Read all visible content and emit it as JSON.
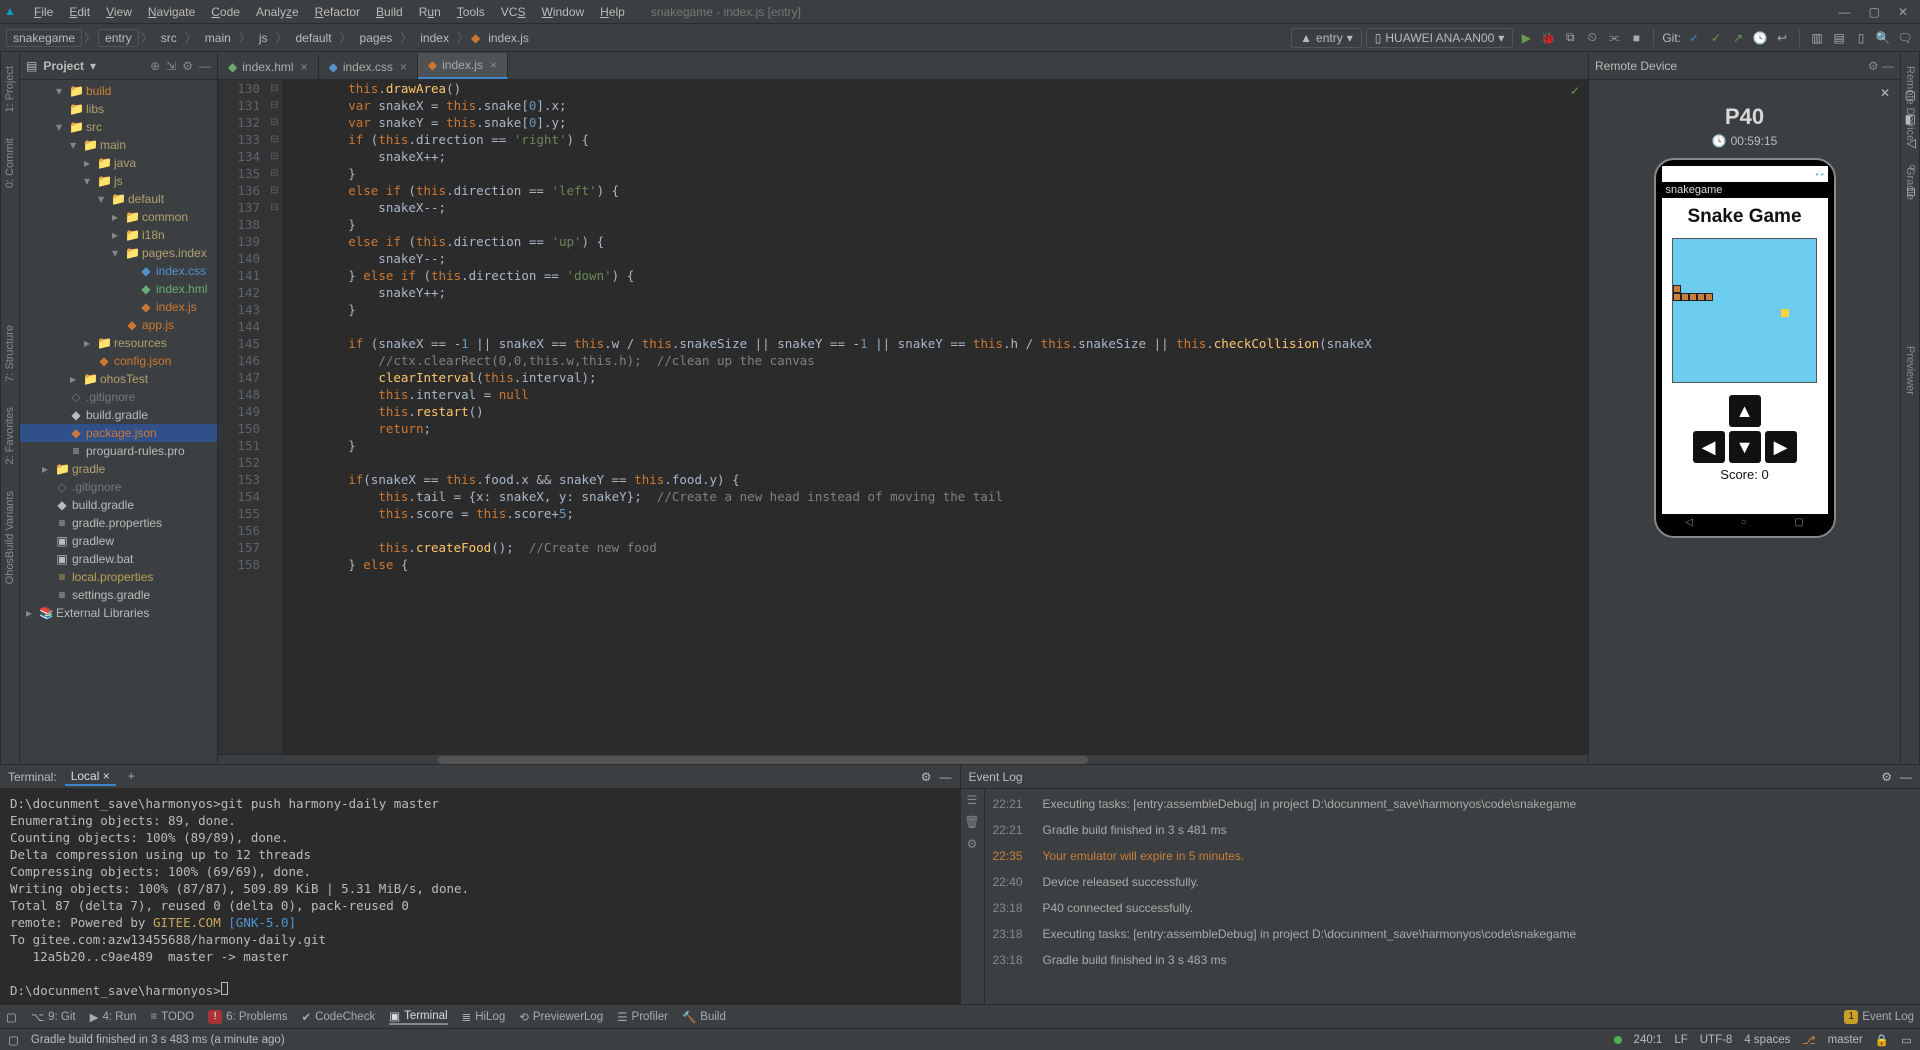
{
  "window": {
    "title": "snakegame - index.js [entry]"
  },
  "menu": [
    "File",
    "Edit",
    "View",
    "Navigate",
    "Code",
    "Analyze",
    "Refactor",
    "Build",
    "Run",
    "Tools",
    "VCS",
    "Window",
    "Help"
  ],
  "breadcrumbs": [
    "snakegame",
    "entry",
    "src",
    "main",
    "js",
    "default",
    "pages",
    "index",
    "index.js"
  ],
  "runConfig": "entry",
  "device": "HUAWEI ANA-AN00",
  "gitLabel": "Git:",
  "leftTabs": [
    "1: Project",
    "0: Commit",
    "7: Structure",
    "2: Favorites",
    "OhosBuild Variants"
  ],
  "rightTabs": [
    "Remote Device",
    "Gradle",
    "Previewer"
  ],
  "projectPanel": {
    "title": "Project"
  },
  "tree": [
    {
      "d": 1,
      "a": "▾",
      "i": "📁",
      "cls": "build-orange",
      "t": "build"
    },
    {
      "d": 1,
      "a": "",
      "i": "📁",
      "cls": "folder",
      "t": "libs"
    },
    {
      "d": 1,
      "a": "▾",
      "i": "📁",
      "cls": "folder",
      "t": "src"
    },
    {
      "d": 2,
      "a": "▾",
      "i": "📁",
      "cls": "folder",
      "t": "main"
    },
    {
      "d": 3,
      "a": "▸",
      "i": "📁",
      "cls": "folder",
      "t": "java"
    },
    {
      "d": 3,
      "a": "▾",
      "i": "📁",
      "cls": "folder",
      "t": "js"
    },
    {
      "d": 4,
      "a": "▾",
      "i": "📁",
      "cls": "folder",
      "t": "default"
    },
    {
      "d": 5,
      "a": "▸",
      "i": "📁",
      "cls": "folder",
      "t": "common"
    },
    {
      "d": 5,
      "a": "▸",
      "i": "📁",
      "cls": "folder",
      "t": "i18n"
    },
    {
      "d": 5,
      "a": "▾",
      "i": "📁",
      "cls": "folder",
      "t": "pages.index"
    },
    {
      "d": 6,
      "a": "",
      "i": "◆",
      "cls": "file-css",
      "t": "index.css"
    },
    {
      "d": 6,
      "a": "",
      "i": "◆",
      "cls": "file-hml",
      "t": "index.hml"
    },
    {
      "d": 6,
      "a": "",
      "i": "◆",
      "cls": "file-js",
      "t": "index.js"
    },
    {
      "d": 5,
      "a": "",
      "i": "◆",
      "cls": "file-js",
      "t": "app.js"
    },
    {
      "d": 3,
      "a": "▸",
      "i": "📁",
      "cls": "folder",
      "t": "resources"
    },
    {
      "d": 3,
      "a": "",
      "i": "◆",
      "cls": "file-json",
      "t": "config.json"
    },
    {
      "d": 2,
      "a": "▸",
      "i": "📁",
      "cls": "folder",
      "t": "ohosTest"
    },
    {
      "d": 1,
      "a": "",
      "i": "◇",
      "cls": "dim",
      "t": ".gitignore"
    },
    {
      "d": 1,
      "a": "",
      "i": "◆",
      "cls": "",
      "t": "build.gradle"
    },
    {
      "d": 1,
      "a": "",
      "i": "◆",
      "cls": "file-json",
      "t": "package.json",
      "sel": true
    },
    {
      "d": 1,
      "a": "",
      "i": "≡",
      "cls": "",
      "t": "proguard-rules.pro"
    },
    {
      "d": 0,
      "a": "▸",
      "i": "📁",
      "cls": "folder",
      "t": "gradle"
    },
    {
      "d": 0,
      "a": "",
      "i": "◇",
      "cls": "dim",
      "t": ".gitignore"
    },
    {
      "d": 0,
      "a": "",
      "i": "◆",
      "cls": "",
      "t": "build.gradle"
    },
    {
      "d": 0,
      "a": "",
      "i": "≡",
      "cls": "",
      "t": "gradle.properties"
    },
    {
      "d": 0,
      "a": "",
      "i": "▣",
      "cls": "",
      "t": "gradlew"
    },
    {
      "d": 0,
      "a": "",
      "i": "▣",
      "cls": "",
      "t": "gradlew.bat"
    },
    {
      "d": 0,
      "a": "",
      "i": "≡",
      "cls": "yellow",
      "t": "local.properties"
    },
    {
      "d": 0,
      "a": "",
      "i": "≡",
      "cls": "",
      "t": "settings.gradle"
    },
    {
      "d": -1,
      "a": "▸",
      "i": "📚",
      "cls": "",
      "t": "External Libraries"
    }
  ],
  "editorTabs": [
    {
      "name": "index.hml",
      "icon": "file-hml"
    },
    {
      "name": "index.css",
      "icon": "file-css"
    },
    {
      "name": "index.js",
      "icon": "file-js",
      "active": true
    }
  ],
  "lineStart": 130,
  "lineEnd": 158,
  "remote": {
    "title": "Remote Device",
    "deviceName": "P40",
    "timer": "00:59:15",
    "appLabel": "snakegame",
    "gameTitle": "Snake Game",
    "score": "Score: 0"
  },
  "terminal": {
    "title": "Terminal:",
    "tab": "Local",
    "lines": [
      "D:\\docunment_save\\harmonyos>git push harmony-daily master",
      "Enumerating objects: 89, done.",
      "Counting objects: 100% (89/89), done.",
      "Delta compression using up to 12 threads",
      "Compressing objects: 100% (69/69), done.",
      "Writing objects: 100% (87/87), 509.89 KiB | 5.31 MiB/s, done.",
      "Total 87 (delta 7), reused 0 (delta 0), pack-reused 0",
      "remote: Powered by GITEE.COM [GNK-5.0]",
      "To gitee.com:azw13455688/harmony-daily.git",
      "   12a5b20..c9ae489  master -> master",
      "",
      "D:\\docunment_save\\harmonyos>"
    ],
    "remoteHighlight": "GITEE.COM ",
    "remoteHighlight2": "[GNK-5.0]"
  },
  "eventLog": {
    "title": "Event Log",
    "rows": [
      {
        "t": "22:21",
        "m": "Executing tasks: [entry:assembleDebug] in project D:\\docunment_save\\harmonyos\\code\\snakegame"
      },
      {
        "t": "22:21",
        "m": "Gradle build finished in 3 s 481 ms"
      },
      {
        "t": "22:35",
        "m": "Your emulator will expire in 5 minutes.",
        "warn": true
      },
      {
        "t": "22:40",
        "m": "Device released successfully."
      },
      {
        "t": "23:18",
        "m": "P40 connected successfully."
      },
      {
        "t": "23:18",
        "m": "Executing tasks: [entry:assembleDebug] in project D:\\docunment_save\\harmonyos\\code\\snakegame"
      },
      {
        "t": "23:18",
        "m": "Gradle build finished in 3 s 483 ms"
      }
    ]
  },
  "bottomTools": [
    {
      "icon": "⌥",
      "label": "9: Git"
    },
    {
      "icon": "▶",
      "label": "4: Run"
    },
    {
      "icon": "≡",
      "label": "TODO"
    },
    {
      "icon": "!",
      "badge": "red",
      "label": "6: Problems"
    },
    {
      "icon": "✔",
      "label": "CodeCheck"
    },
    {
      "icon": "▣",
      "label": "Terminal",
      "active": true
    },
    {
      "icon": "≣",
      "label": "HiLog"
    },
    {
      "icon": "⟲",
      "label": "PreviewerLog"
    },
    {
      "icon": "☰",
      "label": "Profiler"
    },
    {
      "icon": "🔨",
      "label": "Build"
    }
  ],
  "eventLogBadge": "Event Log",
  "status": {
    "msg": "Gradle build finished in 3 s 483 ms (a minute ago)",
    "pos": "240:1",
    "eol": "LF",
    "enc": "UTF-8",
    "indent": "4 spaces",
    "branch": "master"
  }
}
